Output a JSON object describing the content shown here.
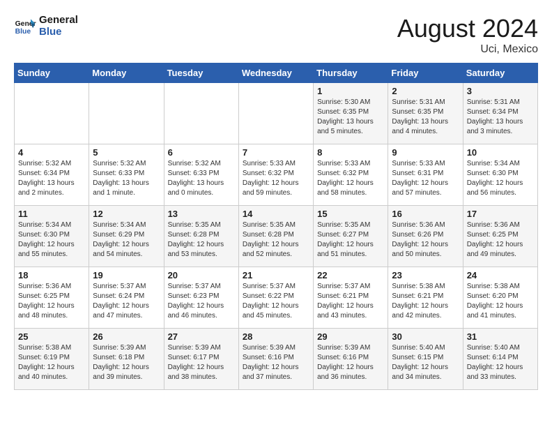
{
  "header": {
    "logo_line1": "General",
    "logo_line2": "Blue",
    "month_year": "August 2024",
    "location": "Uci, Mexico"
  },
  "days_of_week": [
    "Sunday",
    "Monday",
    "Tuesday",
    "Wednesday",
    "Thursday",
    "Friday",
    "Saturday"
  ],
  "weeks": [
    [
      {
        "day": "",
        "info": ""
      },
      {
        "day": "",
        "info": ""
      },
      {
        "day": "",
        "info": ""
      },
      {
        "day": "",
        "info": ""
      },
      {
        "day": "1",
        "info": "Sunrise: 5:30 AM\nSunset: 6:35 PM\nDaylight: 13 hours\nand 5 minutes."
      },
      {
        "day": "2",
        "info": "Sunrise: 5:31 AM\nSunset: 6:35 PM\nDaylight: 13 hours\nand 4 minutes."
      },
      {
        "day": "3",
        "info": "Sunrise: 5:31 AM\nSunset: 6:34 PM\nDaylight: 13 hours\nand 3 minutes."
      }
    ],
    [
      {
        "day": "4",
        "info": "Sunrise: 5:32 AM\nSunset: 6:34 PM\nDaylight: 13 hours\nand 2 minutes."
      },
      {
        "day": "5",
        "info": "Sunrise: 5:32 AM\nSunset: 6:33 PM\nDaylight: 13 hours\nand 1 minute."
      },
      {
        "day": "6",
        "info": "Sunrise: 5:32 AM\nSunset: 6:33 PM\nDaylight: 13 hours\nand 0 minutes."
      },
      {
        "day": "7",
        "info": "Sunrise: 5:33 AM\nSunset: 6:32 PM\nDaylight: 12 hours\nand 59 minutes."
      },
      {
        "day": "8",
        "info": "Sunrise: 5:33 AM\nSunset: 6:32 PM\nDaylight: 12 hours\nand 58 minutes."
      },
      {
        "day": "9",
        "info": "Sunrise: 5:33 AM\nSunset: 6:31 PM\nDaylight: 12 hours\nand 57 minutes."
      },
      {
        "day": "10",
        "info": "Sunrise: 5:34 AM\nSunset: 6:30 PM\nDaylight: 12 hours\nand 56 minutes."
      }
    ],
    [
      {
        "day": "11",
        "info": "Sunrise: 5:34 AM\nSunset: 6:30 PM\nDaylight: 12 hours\nand 55 minutes."
      },
      {
        "day": "12",
        "info": "Sunrise: 5:34 AM\nSunset: 6:29 PM\nDaylight: 12 hours\nand 54 minutes."
      },
      {
        "day": "13",
        "info": "Sunrise: 5:35 AM\nSunset: 6:28 PM\nDaylight: 12 hours\nand 53 minutes."
      },
      {
        "day": "14",
        "info": "Sunrise: 5:35 AM\nSunset: 6:28 PM\nDaylight: 12 hours\nand 52 minutes."
      },
      {
        "day": "15",
        "info": "Sunrise: 5:35 AM\nSunset: 6:27 PM\nDaylight: 12 hours\nand 51 minutes."
      },
      {
        "day": "16",
        "info": "Sunrise: 5:36 AM\nSunset: 6:26 PM\nDaylight: 12 hours\nand 50 minutes."
      },
      {
        "day": "17",
        "info": "Sunrise: 5:36 AM\nSunset: 6:25 PM\nDaylight: 12 hours\nand 49 minutes."
      }
    ],
    [
      {
        "day": "18",
        "info": "Sunrise: 5:36 AM\nSunset: 6:25 PM\nDaylight: 12 hours\nand 48 minutes."
      },
      {
        "day": "19",
        "info": "Sunrise: 5:37 AM\nSunset: 6:24 PM\nDaylight: 12 hours\nand 47 minutes."
      },
      {
        "day": "20",
        "info": "Sunrise: 5:37 AM\nSunset: 6:23 PM\nDaylight: 12 hours\nand 46 minutes."
      },
      {
        "day": "21",
        "info": "Sunrise: 5:37 AM\nSunset: 6:22 PM\nDaylight: 12 hours\nand 45 minutes."
      },
      {
        "day": "22",
        "info": "Sunrise: 5:37 AM\nSunset: 6:21 PM\nDaylight: 12 hours\nand 43 minutes."
      },
      {
        "day": "23",
        "info": "Sunrise: 5:38 AM\nSunset: 6:21 PM\nDaylight: 12 hours\nand 42 minutes."
      },
      {
        "day": "24",
        "info": "Sunrise: 5:38 AM\nSunset: 6:20 PM\nDaylight: 12 hours\nand 41 minutes."
      }
    ],
    [
      {
        "day": "25",
        "info": "Sunrise: 5:38 AM\nSunset: 6:19 PM\nDaylight: 12 hours\nand 40 minutes."
      },
      {
        "day": "26",
        "info": "Sunrise: 5:39 AM\nSunset: 6:18 PM\nDaylight: 12 hours\nand 39 minutes."
      },
      {
        "day": "27",
        "info": "Sunrise: 5:39 AM\nSunset: 6:17 PM\nDaylight: 12 hours\nand 38 minutes."
      },
      {
        "day": "28",
        "info": "Sunrise: 5:39 AM\nSunset: 6:16 PM\nDaylight: 12 hours\nand 37 minutes."
      },
      {
        "day": "29",
        "info": "Sunrise: 5:39 AM\nSunset: 6:16 PM\nDaylight: 12 hours\nand 36 minutes."
      },
      {
        "day": "30",
        "info": "Sunrise: 5:40 AM\nSunset: 6:15 PM\nDaylight: 12 hours\nand 34 minutes."
      },
      {
        "day": "31",
        "info": "Sunrise: 5:40 AM\nSunset: 6:14 PM\nDaylight: 12 hours\nand 33 minutes."
      }
    ]
  ]
}
